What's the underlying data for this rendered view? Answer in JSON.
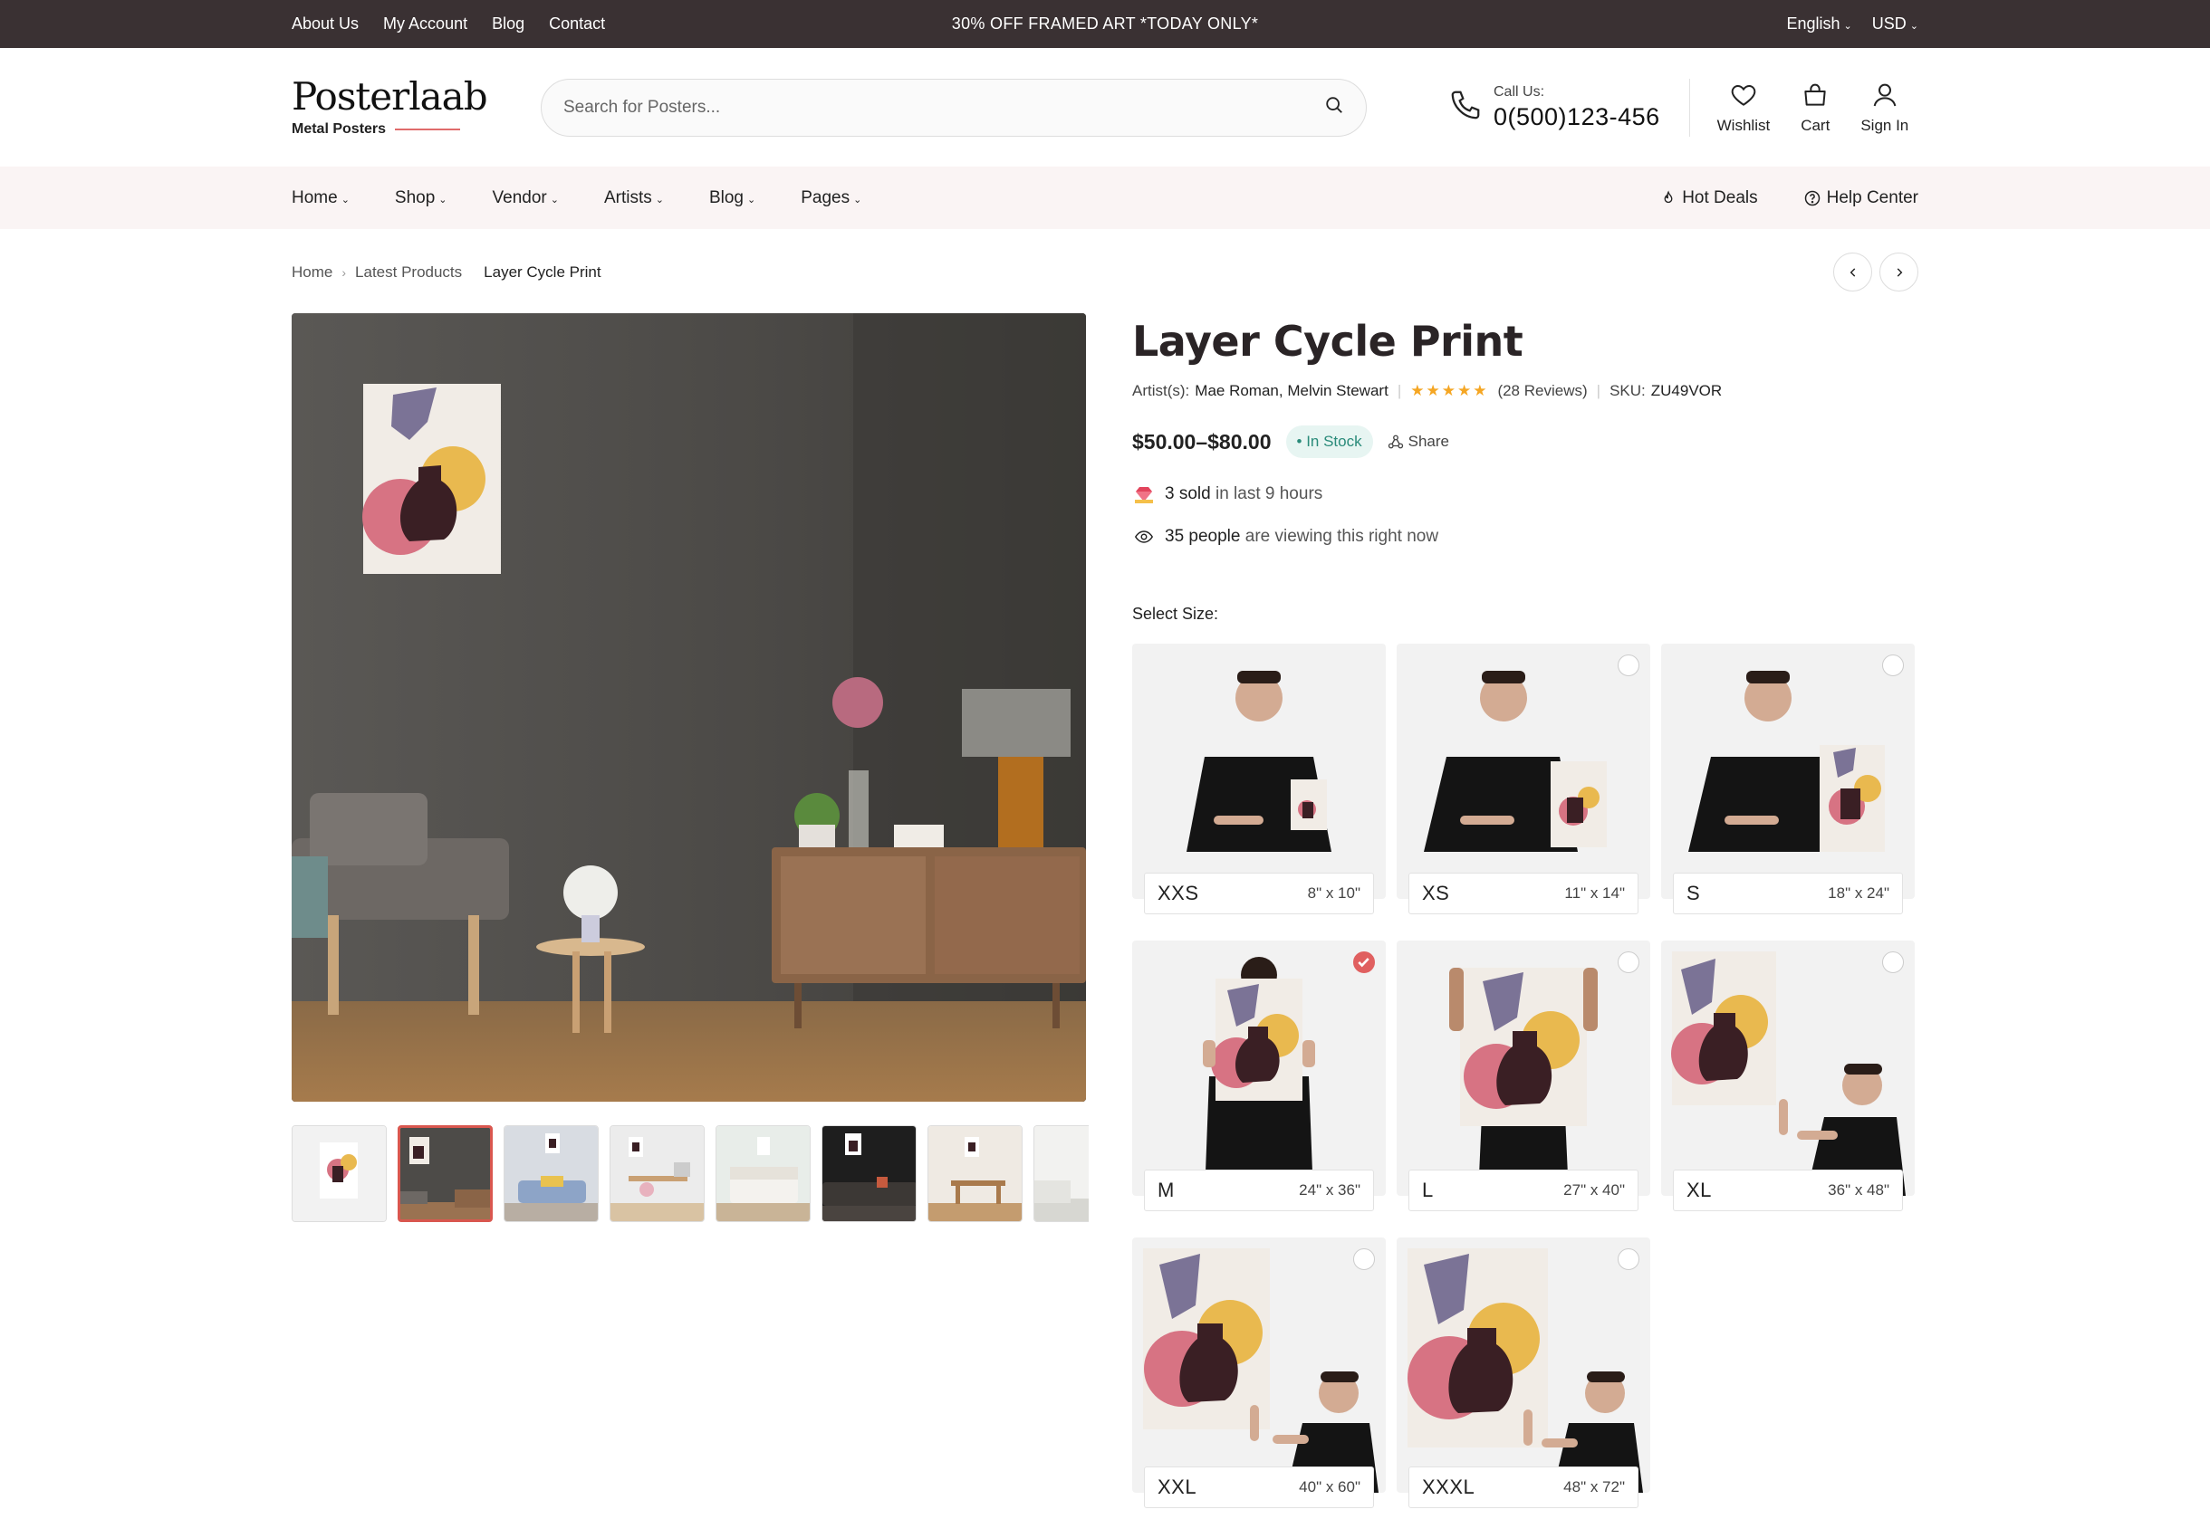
{
  "topbar": {
    "links": [
      "About Us",
      "My Account",
      "Blog",
      "Contact"
    ],
    "promo": "30% OFF FRAMED ART *TODAY ONLY*",
    "language": "English",
    "currency": "USD"
  },
  "header": {
    "logo_title": "Posterlaab",
    "logo_sub": "Metal Posters",
    "search_placeholder": "Search for Posters...",
    "call_label": "Call Us:",
    "phone": "0(500)123-456",
    "wishlist": "Wishlist",
    "cart": "Cart",
    "signin": "Sign In"
  },
  "nav": {
    "items": [
      "Home",
      "Shop",
      "Vendor",
      "Artists",
      "Blog",
      "Pages"
    ],
    "hot_deals": "Hot Deals",
    "help_center": "Help Center"
  },
  "breadcrumb": [
    "Home",
    "Latest Products",
    "Layer Cycle Print"
  ],
  "product": {
    "title": "Layer Cycle Print",
    "artists_label": "Artist(s):",
    "artists": "Mae Roman, Melvin Stewart",
    "rating": 5,
    "stars": "★★★★★",
    "reviews": "(28 Reviews)",
    "sku_label": "SKU:",
    "sku": "ZU49VOR",
    "price": "$50.00–$80.00",
    "stock": "In Stock",
    "share": "Share",
    "sold_count": "3 sold",
    "sold_suffix": "in last 9 hours",
    "viewers_count": "35 people",
    "viewers_suffix": "are viewing this right now",
    "select_size_label": "Select Size:"
  },
  "sizes": [
    {
      "size": "XXS",
      "dims": "8\" x 10\"",
      "selected": false
    },
    {
      "size": "XS",
      "dims": "11\" x 14\"",
      "selected": false
    },
    {
      "size": "S",
      "dims": "18\" x 24\"",
      "selected": false
    },
    {
      "size": "M",
      "dims": "24\" x 36\"",
      "selected": true
    },
    {
      "size": "L",
      "dims": "27\" x 40\"",
      "selected": false
    },
    {
      "size": "XL",
      "dims": "36\" x 48\"",
      "selected": false
    },
    {
      "size": "XXL",
      "dims": "40\" x 60\"",
      "selected": false
    },
    {
      "size": "XXXL",
      "dims": "48\" x 72\"",
      "selected": false
    }
  ],
  "colors": {
    "topbar_bg": "#3a3133",
    "nav_bg": "#faf4f4",
    "accent": "#d9574f",
    "stock_text": "#2a8b7a",
    "star": "#f5a623"
  }
}
